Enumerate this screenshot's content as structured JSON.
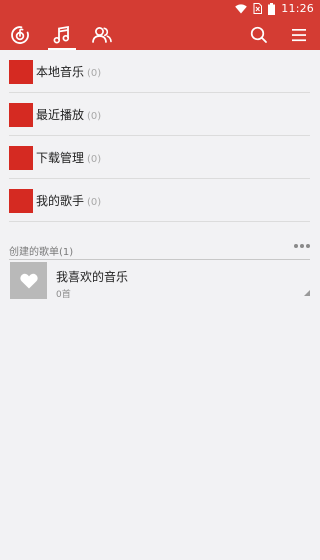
{
  "status_bar": {
    "time": "11:26",
    "icons": [
      "wifi-icon",
      "no-sim-icon",
      "battery-icon"
    ]
  },
  "header": {
    "tabs": [
      {
        "icon": "netease-music-logo-icon",
        "active": false
      },
      {
        "icon": "music-note-icon",
        "active": true
      },
      {
        "icon": "friends-icon",
        "active": false
      }
    ],
    "actions": [
      {
        "icon": "search-icon"
      },
      {
        "icon": "menu-icon"
      }
    ],
    "colors": {
      "accent": "#d43c33",
      "tile": "#d52a22"
    }
  },
  "menu": {
    "items": [
      {
        "label": "本地音乐",
        "count": "(0)"
      },
      {
        "label": "最近播放",
        "count": "(0)"
      },
      {
        "label": "下载管理",
        "count": "(0)"
      },
      {
        "label": "我的歌手",
        "count": "(0)"
      }
    ]
  },
  "playlists": {
    "header": "创建的歌单(1)",
    "items": [
      {
        "title": "我喜欢的音乐",
        "count": "0首",
        "icon": "heart-icon"
      }
    ]
  }
}
